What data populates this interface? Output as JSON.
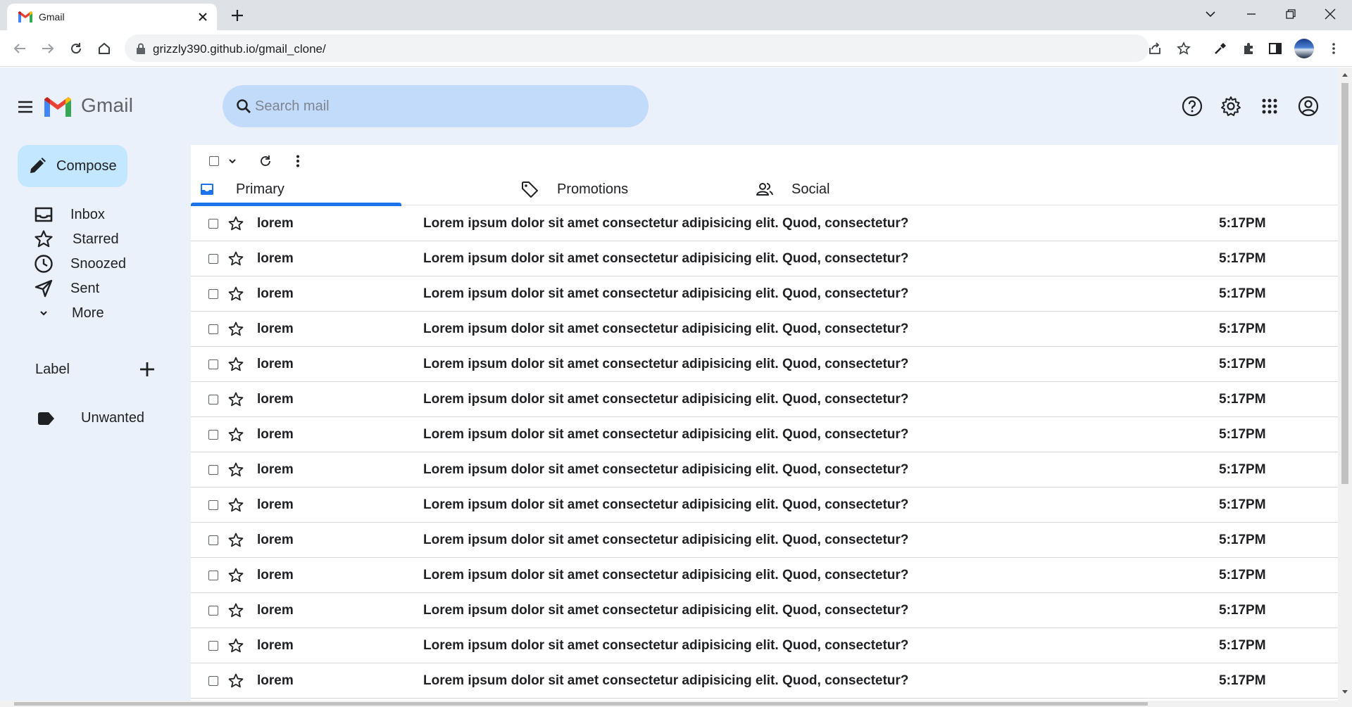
{
  "browser": {
    "tab_title": "Gmail",
    "url": "grizzly390.github.io/gmail_clone/"
  },
  "header": {
    "brand": "Gmail",
    "search_placeholder": "Search mail",
    "icons": [
      "menu-icon",
      "help-icon",
      "settings-icon",
      "apps-icon",
      "account-icon"
    ]
  },
  "sidebar": {
    "compose_label": "Compose",
    "items": [
      {
        "label": "Inbox",
        "icon": "inbox-icon"
      },
      {
        "label": "Starred",
        "icon": "star-icon"
      },
      {
        "label": "Snoozed",
        "icon": "clock-icon"
      },
      {
        "label": "Sent",
        "icon": "send-icon"
      },
      {
        "label": "More",
        "icon": "chevron-down-icon"
      }
    ],
    "label_header": "Label",
    "labels": [
      {
        "label": "Unwanted",
        "icon": "label-icon"
      }
    ]
  },
  "tabs": [
    {
      "label": "Primary",
      "icon": "inbox-icon",
      "active": true
    },
    {
      "label": "Promotions",
      "icon": "tag-icon",
      "active": false
    },
    {
      "label": "Social",
      "icon": "people-icon",
      "active": false
    }
  ],
  "emails": [
    {
      "sender": "lorem",
      "subject": "Lorem ipsum dolor sit amet consectetur adipisicing elit. Quod, consectetur?",
      "time": "5:17PM"
    },
    {
      "sender": "lorem",
      "subject": "Lorem ipsum dolor sit amet consectetur adipisicing elit. Quod, consectetur?",
      "time": "5:17PM"
    },
    {
      "sender": "lorem",
      "subject": "Lorem ipsum dolor sit amet consectetur adipisicing elit. Quod, consectetur?",
      "time": "5:17PM"
    },
    {
      "sender": "lorem",
      "subject": "Lorem ipsum dolor sit amet consectetur adipisicing elit. Quod, consectetur?",
      "time": "5:17PM"
    },
    {
      "sender": "lorem",
      "subject": "Lorem ipsum dolor sit amet consectetur adipisicing elit. Quod, consectetur?",
      "time": "5:17PM"
    },
    {
      "sender": "lorem",
      "subject": "Lorem ipsum dolor sit amet consectetur adipisicing elit. Quod, consectetur?",
      "time": "5:17PM"
    },
    {
      "sender": "lorem",
      "subject": "Lorem ipsum dolor sit amet consectetur adipisicing elit. Quod, consectetur?",
      "time": "5:17PM"
    },
    {
      "sender": "lorem",
      "subject": "Lorem ipsum dolor sit amet consectetur adipisicing elit. Quod, consectetur?",
      "time": "5:17PM"
    },
    {
      "sender": "lorem",
      "subject": "Lorem ipsum dolor sit amet consectetur adipisicing elit. Quod, consectetur?",
      "time": "5:17PM"
    },
    {
      "sender": "lorem",
      "subject": "Lorem ipsum dolor sit amet consectetur adipisicing elit. Quod, consectetur?",
      "time": "5:17PM"
    },
    {
      "sender": "lorem",
      "subject": "Lorem ipsum dolor sit amet consectetur adipisicing elit. Quod, consectetur?",
      "time": "5:17PM"
    },
    {
      "sender": "lorem",
      "subject": "Lorem ipsum dolor sit amet consectetur adipisicing elit. Quod, consectetur?",
      "time": "5:17PM"
    },
    {
      "sender": "lorem",
      "subject": "Lorem ipsum dolor sit amet consectetur adipisicing elit. Quod, consectetur?",
      "time": "5:17PM"
    },
    {
      "sender": "lorem",
      "subject": "Lorem ipsum dolor sit amet consectetur adipisicing elit. Quod, consectetur?",
      "time": "5:17PM"
    }
  ],
  "colors": {
    "page_background": "#eaf1fb",
    "search_background": "#c2dbfb",
    "compose_background": "#c2e7ff",
    "active_tab_indicator": "#1a73e8"
  }
}
